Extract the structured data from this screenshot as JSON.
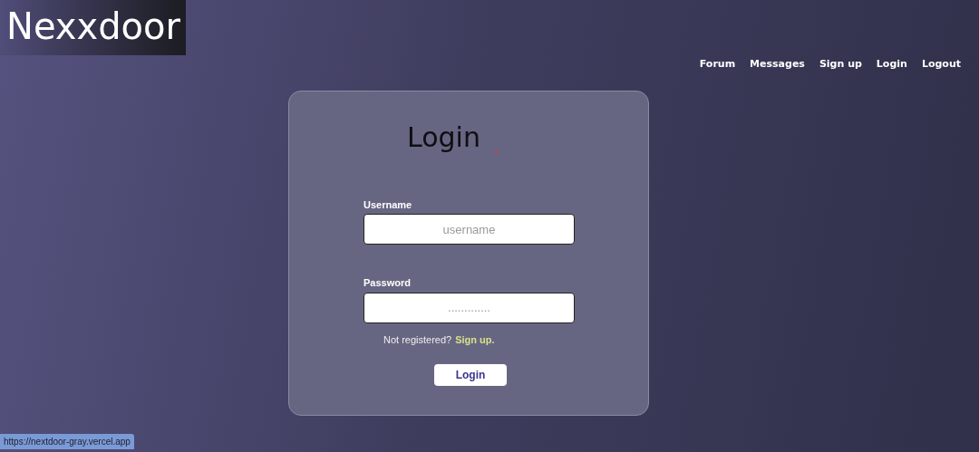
{
  "logo": "Nexxdoor",
  "nav": [
    {
      "label": "Forum"
    },
    {
      "label": "Messages"
    },
    {
      "label": "Sign up"
    },
    {
      "label": "Login"
    },
    {
      "label": "Logout"
    }
  ],
  "form": {
    "title": "Login",
    "fields": [
      {
        "label": "Username",
        "placeholder": "username"
      },
      {
        "label": "Password",
        "placeholder": "............."
      }
    ],
    "prompt": "Not registered?",
    "link": "Sign up.",
    "button": "Login"
  },
  "status_bar": "https://nextdoor-gray.vercel.app"
}
